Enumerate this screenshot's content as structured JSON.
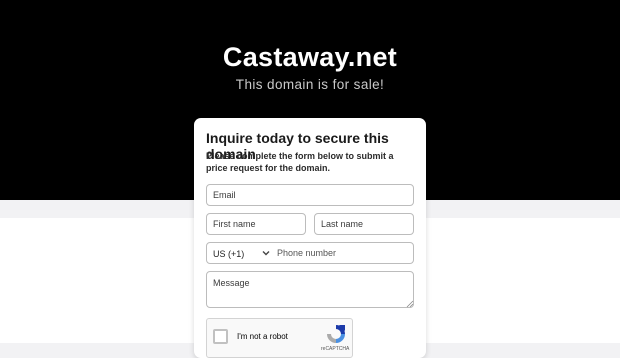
{
  "hero": {
    "title": "Castaway.net",
    "subtitle": "This domain is for sale!"
  },
  "form": {
    "heading": "Inquire today to secure this domain",
    "description": "Please complete the form below to submit a price request for the domain.",
    "email_placeholder": "Email",
    "first_name_placeholder": "First name",
    "last_name_placeholder": "Last name",
    "country_code": "US (+1)",
    "phone_placeholder": "Phone number",
    "message_placeholder": "Message"
  },
  "captcha": {
    "label": "I'm not a robot",
    "brand": "reCAPTCHA"
  },
  "colors": {
    "hero_bg": "#000000",
    "page_bg": "#ffffff",
    "band_bg": "#f2f2f4"
  }
}
